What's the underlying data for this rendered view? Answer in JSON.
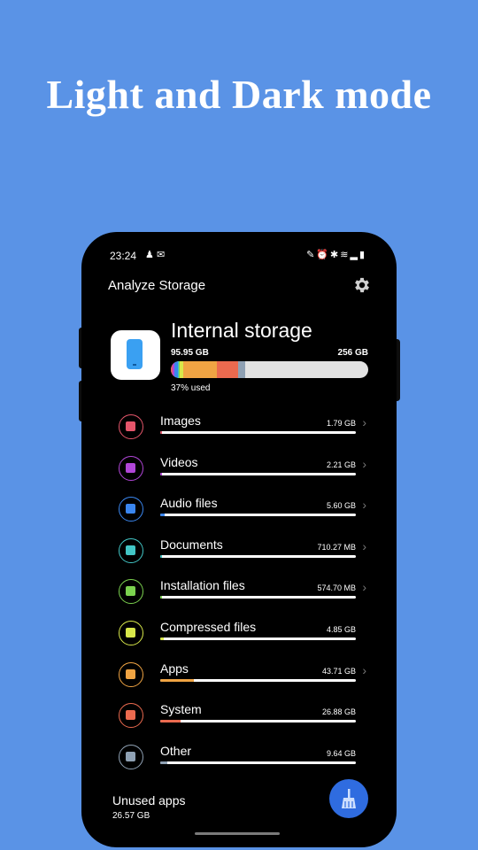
{
  "headline": "Light and Dark mode",
  "status_bar": {
    "time": "23:24",
    "notification_icons": [
      "notification-icon",
      "notification-icon"
    ],
    "system_icons": [
      "pen-icon",
      "alarm-icon",
      "bluetooth-icon",
      "wifi-icon",
      "signal-icon",
      "battery-icon"
    ]
  },
  "app_bar": {
    "title": "Analyze Storage",
    "settings_icon": "gear-icon"
  },
  "storage": {
    "title": "Internal storage",
    "used": "95.95 GB",
    "total": "256 GB",
    "used_percent_label": "37% used",
    "used_fraction": 0.37,
    "bar_segments": [
      {
        "name": "Images",
        "fraction": 0.007,
        "color": "#e5566b"
      },
      {
        "name": "Videos",
        "fraction": 0.009,
        "color": "#b146d8"
      },
      {
        "name": "Audio files",
        "fraction": 0.022,
        "color": "#3a86ef"
      },
      {
        "name": "Documents",
        "fraction": 0.003,
        "color": "#42c6c6"
      },
      {
        "name": "Installation files",
        "fraction": 0.003,
        "color": "#7bd24f"
      },
      {
        "name": "Compressed files",
        "fraction": 0.019,
        "color": "#d8e84a"
      },
      {
        "name": "Apps",
        "fraction": 0.171,
        "color": "#f0a443"
      },
      {
        "name": "System",
        "fraction": 0.105,
        "color": "#eb6a4f"
      },
      {
        "name": "Other",
        "fraction": 0.038,
        "color": "#8fa1b4"
      }
    ]
  },
  "categories": [
    {
      "name": "Images",
      "size": "1.79 GB",
      "fraction": 0.007,
      "color": "#e5566b",
      "icon": "image-icon",
      "chevron": true
    },
    {
      "name": "Videos",
      "size": "2.21 GB",
      "fraction": 0.009,
      "color": "#b146d8",
      "icon": "video-icon",
      "chevron": true
    },
    {
      "name": "Audio files",
      "size": "5.60 GB",
      "fraction": 0.022,
      "color": "#3a86ef",
      "icon": "headphones-icon",
      "chevron": true
    },
    {
      "name": "Documents",
      "size": "710.27 MB",
      "fraction": 0.003,
      "color": "#42c6c6",
      "icon": "document-icon",
      "chevron": true
    },
    {
      "name": "Installation files",
      "size": "574.70 MB",
      "fraction": 0.003,
      "color": "#7bd24f",
      "icon": "android-icon",
      "chevron": true
    },
    {
      "name": "Compressed files",
      "size": "4.85 GB",
      "fraction": 0.019,
      "color": "#d8e84a",
      "icon": "archive-folder-icon",
      "chevron": false
    },
    {
      "name": "Apps",
      "size": "43.71 GB",
      "fraction": 0.171,
      "color": "#f0a443",
      "icon": "apps-icon",
      "chevron": true
    },
    {
      "name": "System",
      "size": "26.88 GB",
      "fraction": 0.105,
      "color": "#eb6a4f",
      "icon": "system-icon",
      "chevron": false
    },
    {
      "name": "Other",
      "size": "9.64 GB",
      "fraction": 0.038,
      "color": "#8fa1b4",
      "icon": "gears-icon",
      "chevron": false
    }
  ],
  "unused_apps": {
    "label": "Unused apps",
    "size": "26.57 GB"
  },
  "fab": {
    "icon": "broom-icon",
    "color": "#2f6ce0"
  }
}
